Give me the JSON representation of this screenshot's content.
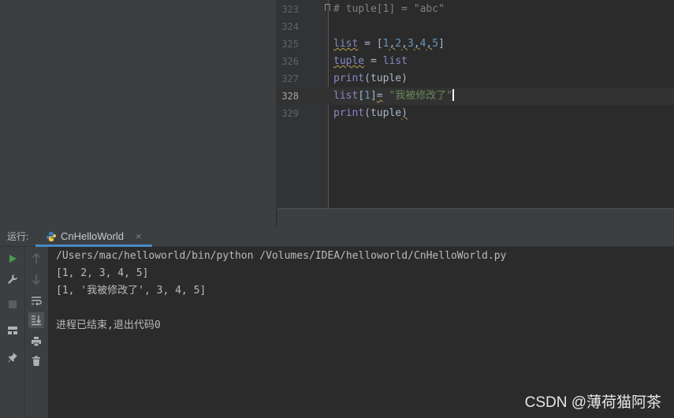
{
  "editor": {
    "lines": [
      {
        "num": "323",
        "segments": [
          {
            "t": "# tuple[1] = \"abc\"",
            "c": "c-comment"
          }
        ]
      },
      {
        "num": "324",
        "segments": []
      },
      {
        "num": "325",
        "segments": [
          {
            "t": "list",
            "c": "c-builtin squig"
          },
          {
            "t": " = [",
            "c": ""
          },
          {
            "t": "1",
            "c": "c-num"
          },
          {
            "t": ",",
            "c": "squig"
          },
          {
            "t": "2",
            "c": "c-num"
          },
          {
            "t": ",",
            "c": "squig"
          },
          {
            "t": "3",
            "c": "c-num"
          },
          {
            "t": ",",
            "c": "squig"
          },
          {
            "t": "4",
            "c": "c-num"
          },
          {
            "t": ",",
            "c": "squig"
          },
          {
            "t": "5",
            "c": "c-num"
          },
          {
            "t": "]",
            "c": ""
          }
        ]
      },
      {
        "num": "326",
        "segments": [
          {
            "t": "tuple",
            "c": "c-builtin squig"
          },
          {
            "t": " = ",
            "c": ""
          },
          {
            "t": "list",
            "c": "c-builtin"
          }
        ]
      },
      {
        "num": "327",
        "segments": [
          {
            "t": "print",
            "c": "c-builtin"
          },
          {
            "t": "(tuple)",
            "c": ""
          }
        ]
      },
      {
        "num": "328",
        "current": true,
        "segments": [
          {
            "t": "list",
            "c": "c-builtin"
          },
          {
            "t": "[",
            "c": ""
          },
          {
            "t": "1",
            "c": "c-num"
          },
          {
            "t": "]",
            "c": ""
          },
          {
            "t": "=",
            "c": "squig"
          },
          {
            "t": " ",
            "c": ""
          },
          {
            "t": "\"我被修改了\"",
            "c": "c-str"
          }
        ]
      },
      {
        "num": "329",
        "segments": [
          {
            "t": "print",
            "c": "c-builtin"
          },
          {
            "t": "(tuple",
            "c": ""
          },
          {
            "t": ")",
            "c": "squig"
          }
        ]
      }
    ]
  },
  "run_panel": {
    "label": "运行:",
    "tab_label": "CnHelloWorld",
    "tab_close": "×",
    "console_lines": [
      "/Users/mac/helloworld/bin/python /Volumes/IDEA/helloworld/CnHelloWorld.py",
      "[1, 2, 3, 4, 5]",
      "[1, '我被修改了', 3, 4, 5]",
      "",
      "进程已结束,退出代码0"
    ]
  },
  "toolbar_icons": {
    "left": [
      "run-icon",
      "wrench-icon",
      "stop-icon",
      "layout-icon",
      "pin-icon"
    ],
    "right": [
      "arrow-up-icon",
      "arrow-down-icon",
      "soft-wrap-icon",
      "scroll-to-end-icon",
      "print-icon",
      "trash-icon"
    ]
  },
  "watermark": "CSDN @薄荷猫阿茶",
  "colors": {
    "background": "#2b2b2b",
    "panel": "#3c3f41",
    "keyword_builtin": "#8888c6",
    "number": "#6897bb",
    "string": "#6a8759",
    "comment": "#808080",
    "run_green": "#499c54",
    "tab_underline": "#4a88c7"
  }
}
